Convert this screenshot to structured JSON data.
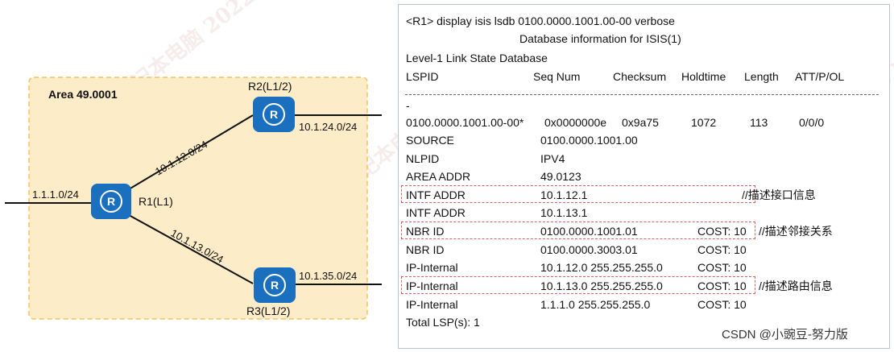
{
  "diagram": {
    "area_label": "Area 49.0001",
    "routers": [
      {
        "id": "r1",
        "label": "R1(L1)"
      },
      {
        "id": "r2",
        "label": "R2(L1/2)"
      },
      {
        "id": "r3",
        "label": "R3(L1/2)"
      }
    ],
    "links": {
      "r1_left": "1.1.1.0/24",
      "r1_r2": "10.1.12.0/24",
      "r1_r3": "10.1.13.0/24",
      "r2_right": "10.1.24.0/24",
      "r3_right": "10.1.35.0/24"
    },
    "colors": {
      "area_fill": "#fdecc8",
      "area_border": "#f3c264",
      "router": "#1a6fbe",
      "link": "#111111"
    }
  },
  "cli": {
    "command": "<R1> display isis lsdb 0100.0000.1001.00-00 verbose",
    "db_title": "Database information for ISIS(1)",
    "db_level": "Level-1 Link State Database",
    "headers": [
      "LSPID",
      "Seq Num",
      "Checksum",
      "Holdtime",
      "Length",
      "ATT/P/OL"
    ],
    "divider_tail": "-",
    "lsp": {
      "lspid": "0100.0000.1001.00-00*",
      "seq": "0x0000000e",
      "checksum": "0x9a75",
      "holdtime": "1072",
      "length": "113",
      "att": "0/0/0"
    },
    "rows": [
      {
        "key": "SOURCE",
        "value": "0100.0000.1001.00",
        "cost": "",
        "note": ""
      },
      {
        "key": "NLPID",
        "value": "IPV4",
        "cost": "",
        "note": ""
      },
      {
        "key": "AREA ADDR",
        "value": "49.0123",
        "cost": "",
        "note": ""
      },
      {
        "key": "INTF ADDR",
        "value": "10.1.12.1",
        "cost": "",
        "note": "//描述接口信息"
      },
      {
        "key": "INTF ADDR",
        "value": "10.1.13.1",
        "cost": "",
        "note": ""
      },
      {
        "key": "NBR ID",
        "value": "0100.0000.1001.01",
        "cost": "COST: 10",
        "note": "//描述邻接关系"
      },
      {
        "key": "NBR ID",
        "value": "0100.0000.3003.01",
        "cost": "COST: 10",
        "note": ""
      },
      {
        "key": "IP-Internal",
        "value": "10.1.12.0 255.255.255.0",
        "cost": "COST: 10",
        "note": ""
      },
      {
        "key": "IP-Internal",
        "value": "10.1.13.0 255.255.255.0",
        "cost": "COST: 10",
        "note": "//描述路由信息"
      },
      {
        "key": "IP-Internal",
        "value": "1.1.1.0 255.255.255.0",
        "cost": "COST: 10",
        "note": ""
      }
    ],
    "total": "Total LSP(s): 1"
  },
  "credit": "CSDN @小豌豆-努力版"
}
